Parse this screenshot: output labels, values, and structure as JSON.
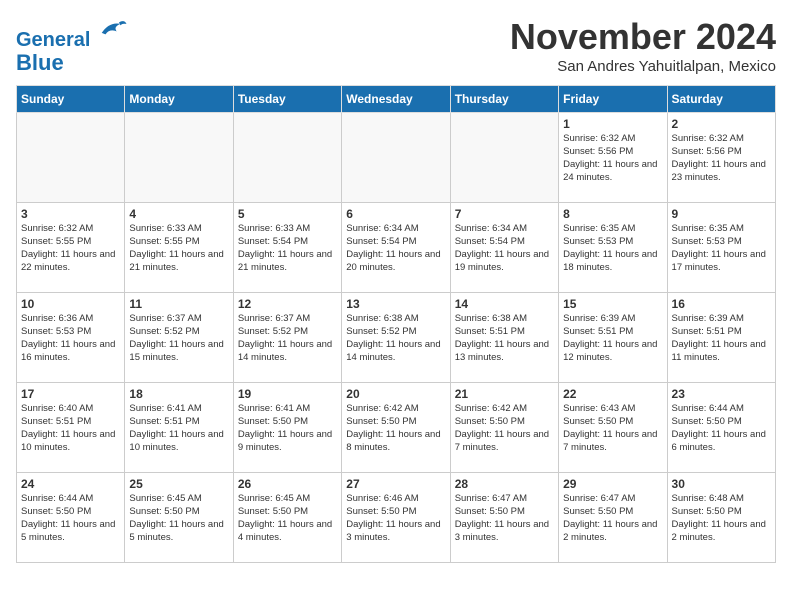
{
  "header": {
    "logo_line1": "General",
    "logo_line2": "Blue",
    "month": "November 2024",
    "location": "San Andres Yahuitlalpan, Mexico"
  },
  "weekdays": [
    "Sunday",
    "Monday",
    "Tuesday",
    "Wednesday",
    "Thursday",
    "Friday",
    "Saturday"
  ],
  "weeks": [
    [
      {
        "day": "",
        "info": ""
      },
      {
        "day": "",
        "info": ""
      },
      {
        "day": "",
        "info": ""
      },
      {
        "day": "",
        "info": ""
      },
      {
        "day": "",
        "info": ""
      },
      {
        "day": "1",
        "info": "Sunrise: 6:32 AM\nSunset: 5:56 PM\nDaylight: 11 hours\nand 24 minutes."
      },
      {
        "day": "2",
        "info": "Sunrise: 6:32 AM\nSunset: 5:56 PM\nDaylight: 11 hours\nand 23 minutes."
      }
    ],
    [
      {
        "day": "3",
        "info": "Sunrise: 6:32 AM\nSunset: 5:55 PM\nDaylight: 11 hours\nand 22 minutes."
      },
      {
        "day": "4",
        "info": "Sunrise: 6:33 AM\nSunset: 5:55 PM\nDaylight: 11 hours\nand 21 minutes."
      },
      {
        "day": "5",
        "info": "Sunrise: 6:33 AM\nSunset: 5:54 PM\nDaylight: 11 hours\nand 21 minutes."
      },
      {
        "day": "6",
        "info": "Sunrise: 6:34 AM\nSunset: 5:54 PM\nDaylight: 11 hours\nand 20 minutes."
      },
      {
        "day": "7",
        "info": "Sunrise: 6:34 AM\nSunset: 5:54 PM\nDaylight: 11 hours\nand 19 minutes."
      },
      {
        "day": "8",
        "info": "Sunrise: 6:35 AM\nSunset: 5:53 PM\nDaylight: 11 hours\nand 18 minutes."
      },
      {
        "day": "9",
        "info": "Sunrise: 6:35 AM\nSunset: 5:53 PM\nDaylight: 11 hours\nand 17 minutes."
      }
    ],
    [
      {
        "day": "10",
        "info": "Sunrise: 6:36 AM\nSunset: 5:53 PM\nDaylight: 11 hours\nand 16 minutes."
      },
      {
        "day": "11",
        "info": "Sunrise: 6:37 AM\nSunset: 5:52 PM\nDaylight: 11 hours\nand 15 minutes."
      },
      {
        "day": "12",
        "info": "Sunrise: 6:37 AM\nSunset: 5:52 PM\nDaylight: 11 hours\nand 14 minutes."
      },
      {
        "day": "13",
        "info": "Sunrise: 6:38 AM\nSunset: 5:52 PM\nDaylight: 11 hours\nand 14 minutes."
      },
      {
        "day": "14",
        "info": "Sunrise: 6:38 AM\nSunset: 5:51 PM\nDaylight: 11 hours\nand 13 minutes."
      },
      {
        "day": "15",
        "info": "Sunrise: 6:39 AM\nSunset: 5:51 PM\nDaylight: 11 hours\nand 12 minutes."
      },
      {
        "day": "16",
        "info": "Sunrise: 6:39 AM\nSunset: 5:51 PM\nDaylight: 11 hours\nand 11 minutes."
      }
    ],
    [
      {
        "day": "17",
        "info": "Sunrise: 6:40 AM\nSunset: 5:51 PM\nDaylight: 11 hours\nand 10 minutes."
      },
      {
        "day": "18",
        "info": "Sunrise: 6:41 AM\nSunset: 5:51 PM\nDaylight: 11 hours\nand 10 minutes."
      },
      {
        "day": "19",
        "info": "Sunrise: 6:41 AM\nSunset: 5:50 PM\nDaylight: 11 hours\nand 9 minutes."
      },
      {
        "day": "20",
        "info": "Sunrise: 6:42 AM\nSunset: 5:50 PM\nDaylight: 11 hours\nand 8 minutes."
      },
      {
        "day": "21",
        "info": "Sunrise: 6:42 AM\nSunset: 5:50 PM\nDaylight: 11 hours\nand 7 minutes."
      },
      {
        "day": "22",
        "info": "Sunrise: 6:43 AM\nSunset: 5:50 PM\nDaylight: 11 hours\nand 7 minutes."
      },
      {
        "day": "23",
        "info": "Sunrise: 6:44 AM\nSunset: 5:50 PM\nDaylight: 11 hours\nand 6 minutes."
      }
    ],
    [
      {
        "day": "24",
        "info": "Sunrise: 6:44 AM\nSunset: 5:50 PM\nDaylight: 11 hours\nand 5 minutes."
      },
      {
        "day": "25",
        "info": "Sunrise: 6:45 AM\nSunset: 5:50 PM\nDaylight: 11 hours\nand 5 minutes."
      },
      {
        "day": "26",
        "info": "Sunrise: 6:45 AM\nSunset: 5:50 PM\nDaylight: 11 hours\nand 4 minutes."
      },
      {
        "day": "27",
        "info": "Sunrise: 6:46 AM\nSunset: 5:50 PM\nDaylight: 11 hours\nand 3 minutes."
      },
      {
        "day": "28",
        "info": "Sunrise: 6:47 AM\nSunset: 5:50 PM\nDaylight: 11 hours\nand 3 minutes."
      },
      {
        "day": "29",
        "info": "Sunrise: 6:47 AM\nSunset: 5:50 PM\nDaylight: 11 hours\nand 2 minutes."
      },
      {
        "day": "30",
        "info": "Sunrise: 6:48 AM\nSunset: 5:50 PM\nDaylight: 11 hours\nand 2 minutes."
      }
    ]
  ]
}
